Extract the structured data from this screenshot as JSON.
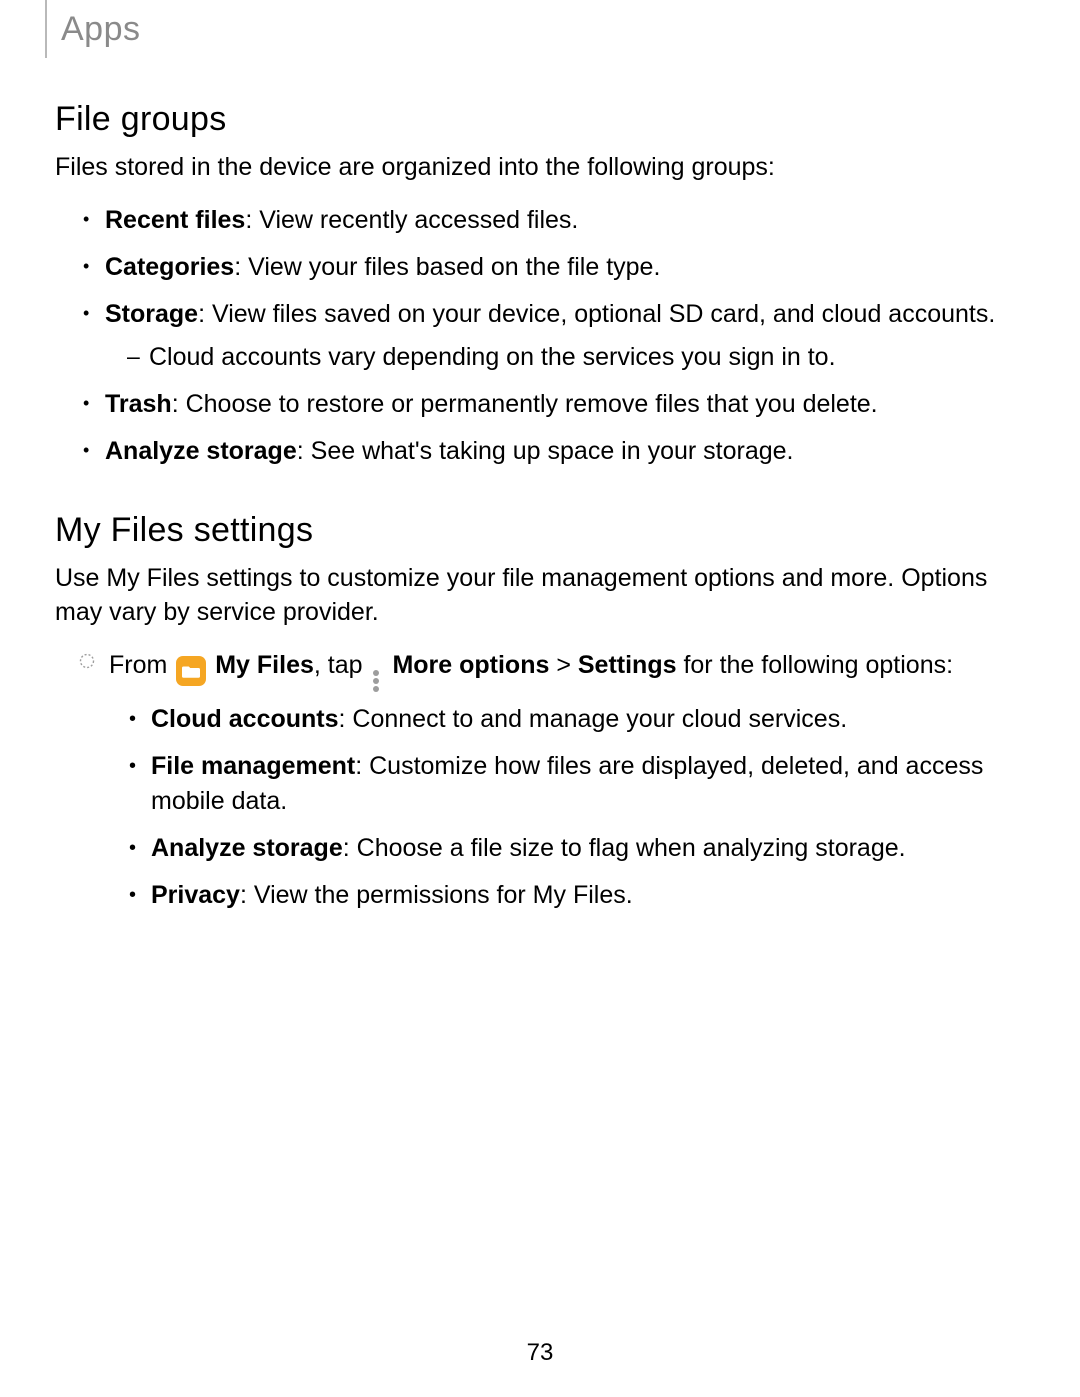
{
  "header": {
    "title": "Apps"
  },
  "section1": {
    "title": "File groups",
    "intro": "Files stored in the device are organized into the following groups:",
    "items": [
      {
        "label": "Recent files",
        "text": ": View recently accessed files."
      },
      {
        "label": "Categories",
        "text": ": View your files based on the file type."
      },
      {
        "label": "Storage",
        "text": ": View files saved on your device, optional SD card, and cloud accounts.",
        "sub": [
          "Cloud accounts vary depending on the services you sign in to."
        ]
      },
      {
        "label": "Trash",
        "text": ": Choose to restore or permanently remove files that you delete."
      },
      {
        "label": "Analyze storage",
        "text": ": See what's taking up space in your storage."
      }
    ]
  },
  "section2": {
    "title": "My Files settings",
    "intro": "Use My Files settings to customize your file management options and more. Options may vary by service provider.",
    "step": {
      "pre": "From ",
      "app_label": "My Files",
      "mid1": ", tap ",
      "more_label": "More options",
      "mid2": " > ",
      "settings_label": "Settings",
      "post": " for the following options:"
    },
    "settings": [
      {
        "label": "Cloud accounts",
        "text": ": Connect to and manage your cloud services."
      },
      {
        "label": "File management",
        "text": ": Customize how files are displayed, deleted, and access mobile data."
      },
      {
        "label": "Analyze storage",
        "text": ": Choose a file size to flag when analyzing storage."
      },
      {
        "label": "Privacy",
        "text": ": View the permissions for My Files."
      }
    ]
  },
  "page_number": "73"
}
